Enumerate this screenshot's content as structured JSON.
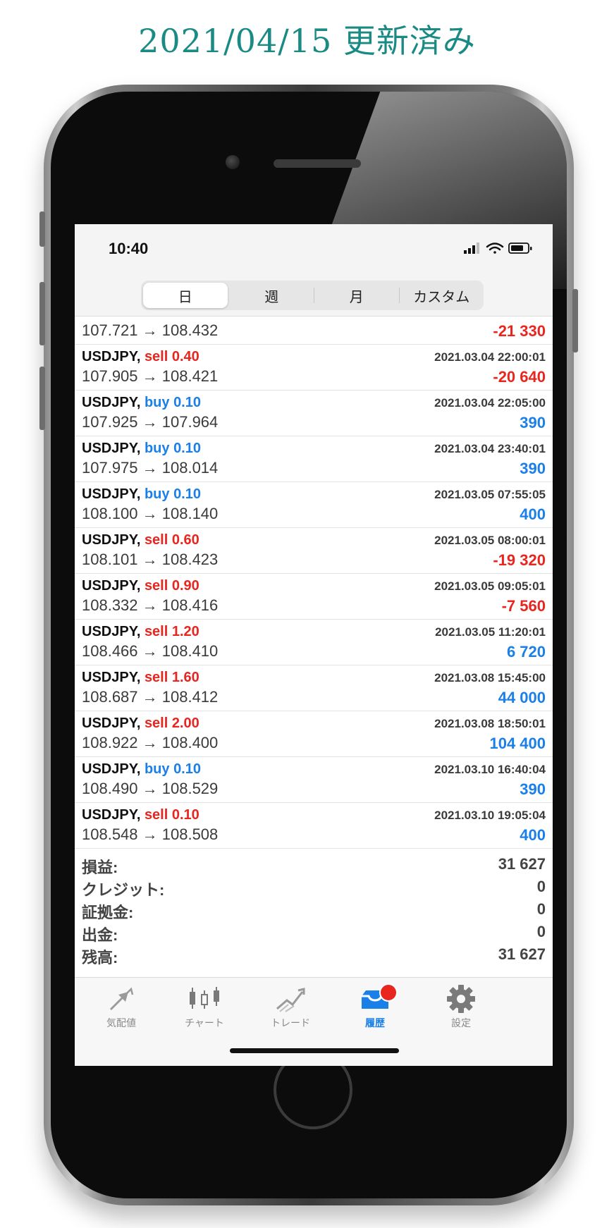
{
  "header": {
    "title": "2021/04/15 更新済み"
  },
  "status_bar": {
    "time": "10:40"
  },
  "segments": [
    "日",
    "週",
    "月",
    "カスタム"
  ],
  "partial_row": {
    "prices": "107.721 → 108.432",
    "profit": "-21 330"
  },
  "trades": [
    {
      "symbol": "USDJPY,",
      "side": "sell",
      "lots": "0.40",
      "date": "2021.03.04 22:00:01",
      "prices": "107.905 → 108.421",
      "profit": "-20 640"
    },
    {
      "symbol": "USDJPY,",
      "side": "buy",
      "lots": "0.10",
      "date": "2021.03.04 22:05:00",
      "prices": "107.925 → 107.964",
      "profit": "390"
    },
    {
      "symbol": "USDJPY,",
      "side": "buy",
      "lots": "0.10",
      "date": "2021.03.04 23:40:01",
      "prices": "107.975 → 108.014",
      "profit": "390"
    },
    {
      "symbol": "USDJPY,",
      "side": "buy",
      "lots": "0.10",
      "date": "2021.03.05 07:55:05",
      "prices": "108.100 → 108.140",
      "profit": "400"
    },
    {
      "symbol": "USDJPY,",
      "side": "sell",
      "lots": "0.60",
      "date": "2021.03.05 08:00:01",
      "prices": "108.101 → 108.423",
      "profit": "-19 320"
    },
    {
      "symbol": "USDJPY,",
      "side": "sell",
      "lots": "0.90",
      "date": "2021.03.05 09:05:01",
      "prices": "108.332 → 108.416",
      "profit": "-7 560"
    },
    {
      "symbol": "USDJPY,",
      "side": "sell",
      "lots": "1.20",
      "date": "2021.03.05 11:20:01",
      "prices": "108.466 → 108.410",
      "profit": "6 720"
    },
    {
      "symbol": "USDJPY,",
      "side": "sell",
      "lots": "1.60",
      "date": "2021.03.08 15:45:00",
      "prices": "108.687 → 108.412",
      "profit": "44 000"
    },
    {
      "symbol": "USDJPY,",
      "side": "sell",
      "lots": "2.00",
      "date": "2021.03.08 18:50:01",
      "prices": "108.922 → 108.400",
      "profit": "104 400"
    },
    {
      "symbol": "USDJPY,",
      "side": "buy",
      "lots": "0.10",
      "date": "2021.03.10 16:40:04",
      "prices": "108.490 → 108.529",
      "profit": "390"
    },
    {
      "symbol": "USDJPY,",
      "side": "sell",
      "lots": "0.10",
      "date": "2021.03.10 19:05:04",
      "prices": "108.548 → 108.508",
      "profit": "400"
    }
  ],
  "summary": [
    {
      "label": "損益:",
      "value": "31 627"
    },
    {
      "label": "クレジット:",
      "value": "0"
    },
    {
      "label": "証拠金:",
      "value": "0"
    },
    {
      "label": "出金:",
      "value": "0"
    },
    {
      "label": "残高:",
      "value": "31 627"
    }
  ],
  "tabs": [
    {
      "label": "気配値",
      "icon": "quotes-arrows-icon"
    },
    {
      "label": "チャート",
      "icon": "candlestick-chart-icon"
    },
    {
      "label": "トレード",
      "icon": "trade-trend-icon"
    },
    {
      "label": "履歴",
      "icon": "history-tray-icon"
    },
    {
      "label": "設定",
      "icon": "settings-gear-icon"
    }
  ],
  "colors": {
    "accent": "#1a8a84",
    "sell": "#e8261f",
    "buy": "#1a80e8",
    "active_tab": "#1a80e8"
  }
}
